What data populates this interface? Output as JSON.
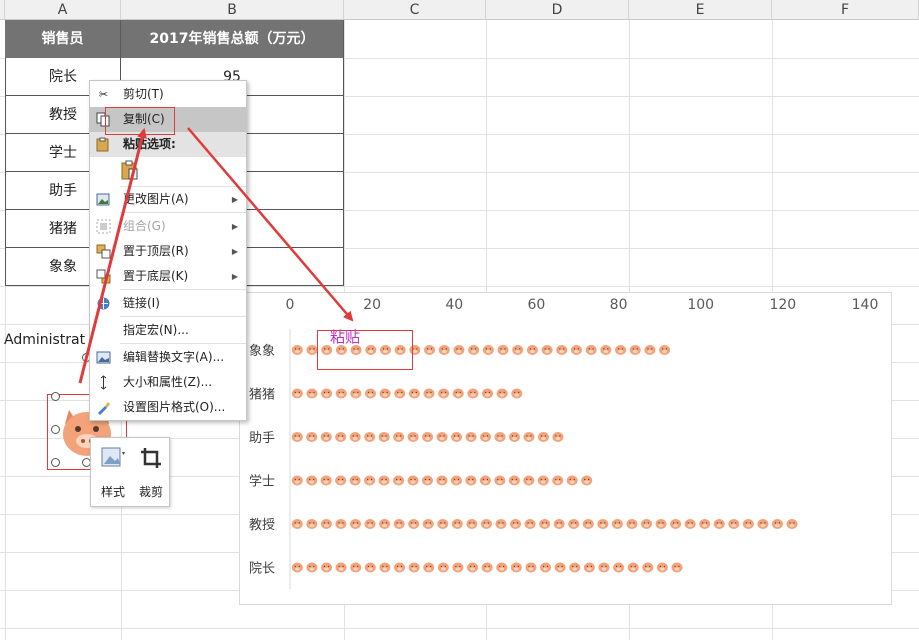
{
  "columns": [
    "A",
    "B",
    "C",
    "D",
    "E",
    "F"
  ],
  "table": {
    "headers": [
      "销售员",
      "2017年销售总额（万元）"
    ],
    "rows": [
      {
        "name": "院长",
        "value": "95"
      },
      {
        "name": "教授",
        "value": ""
      },
      {
        "name": "学士",
        "value": ""
      },
      {
        "name": "助手",
        "value": ""
      },
      {
        "name": "猪猪",
        "value": ""
      },
      {
        "name": "象象",
        "value": ""
      }
    ]
  },
  "admin_text": "Administrat",
  "context_menu": {
    "items": [
      {
        "label": "剪切(T)",
        "icon": "scissors-icon"
      },
      {
        "label": "复制(C)",
        "icon": "copy-icon",
        "highlighted": true
      },
      {
        "label": "粘贴选项:",
        "icon": "paste-icon",
        "header": true
      },
      {
        "label": "更改图片(A)",
        "icon": "change-picture-icon",
        "submenu": true
      },
      {
        "label": "组合(G)",
        "icon": "group-icon",
        "submenu": true,
        "disabled": true
      },
      {
        "label": "置于顶层(R)",
        "icon": "bring-front-icon",
        "submenu": true
      },
      {
        "label": "置于底层(K)",
        "icon": "send-back-icon",
        "submenu": true
      },
      {
        "label": "链接(I)",
        "icon": "link-icon"
      },
      {
        "label": "指定宏(N)...",
        "icon": ""
      },
      {
        "label": "编辑替换文字(A)...",
        "icon": "alt-text-icon"
      },
      {
        "label": "大小和属性(Z)...",
        "icon": "size-icon"
      },
      {
        "label": "设置图片格式(O)...",
        "icon": "format-picture-icon"
      }
    ]
  },
  "mini_toolbar": {
    "style_label": "样式",
    "crop_label": "裁剪"
  },
  "paste_annotation": "粘贴",
  "colors": {
    "header_bg": "#737373",
    "annotation_red": "#e03a3a",
    "paste_text": "#c02fc0",
    "pig_pink": "#f3a27a"
  },
  "chart_data": {
    "type": "bar",
    "orientation": "horizontal",
    "categories": [
      "象象",
      "猪猪",
      "助手",
      "学士",
      "教授",
      "院长"
    ],
    "values": [
      93,
      57,
      67,
      74,
      124,
      96
    ],
    "xlim": [
      0,
      140
    ],
    "xticks": [
      0,
      20,
      40,
      60,
      80,
      100,
      120,
      140
    ],
    "marker": "pig-face-icon",
    "grid": false
  }
}
